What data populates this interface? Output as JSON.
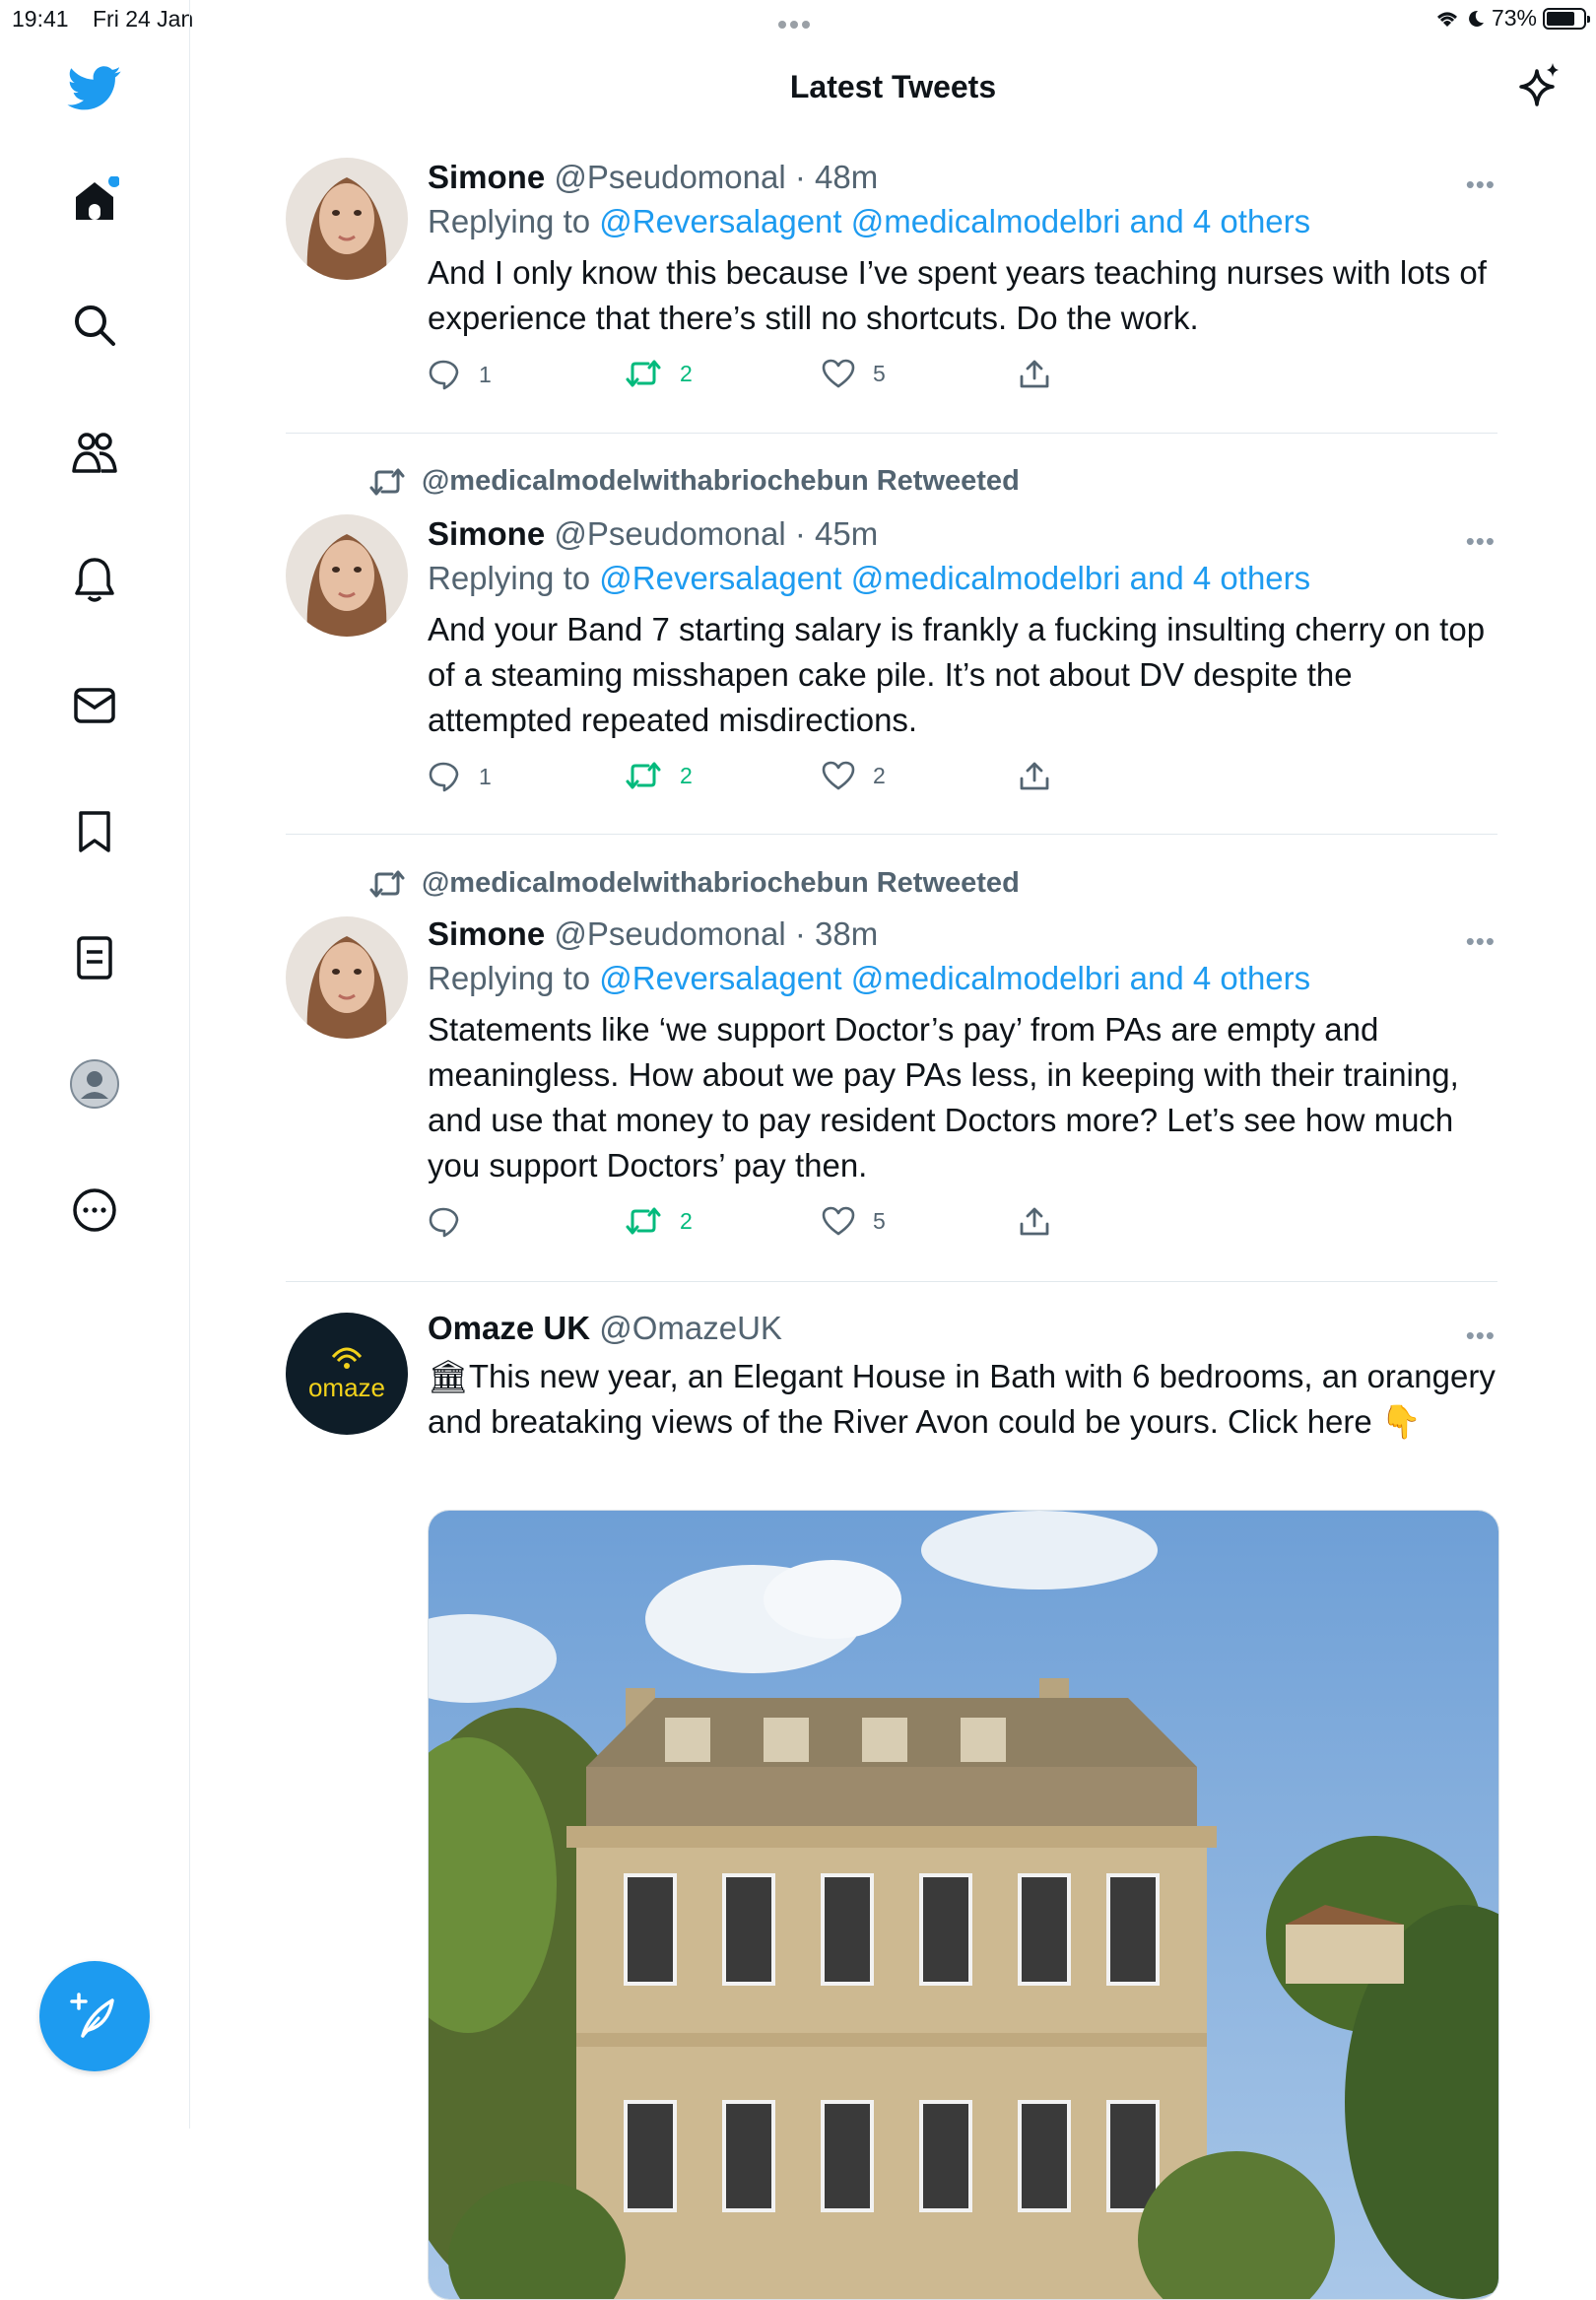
{
  "status_bar": {
    "time": "19:41",
    "date": "Fri 24 Jan",
    "battery": "73%",
    "battery_level": 0.73
  },
  "header": {
    "title": "Latest Tweets"
  },
  "sidebar": {
    "icons": [
      "twitter-logo-icon",
      "home-icon",
      "search-icon",
      "communities-icon",
      "notifications-icon",
      "messages-icon",
      "bookmarks-icon",
      "lists-icon",
      "profile-icon",
      "more-icon"
    ],
    "compose_icon": "compose-tweet-icon"
  },
  "tweets": [
    {
      "retweeted_by": "",
      "name": "Simone",
      "handle": "@Pseudomonal",
      "time": "· 48m",
      "replying_prefix": "Replying to",
      "replying_to": "@Reversalagent @medicalmodelbri and 4 others",
      "text": "And I only know this because I’ve spent years teaching nurses with lots of experience that there’s still no shortcuts. Do the work.",
      "replies": "1",
      "retweets": "2",
      "likes": "5"
    },
    {
      "retweeted_by": "@medicalmodelwithabriochebun Retweeted",
      "name": "Simone",
      "handle": "@Pseudomonal",
      "time": "· 45m",
      "replying_prefix": "Replying to",
      "replying_to": "@Reversalagent @medicalmodelbri and 4 others",
      "text": "And your Band 7 starting salary is frankly a fucking insulting cherry on top of a steaming misshapen cake pile. It’s not about DV despite the attempted repeated misdirections.",
      "replies": "1",
      "retweets": "2",
      "likes": "2"
    },
    {
      "retweeted_by": "@medicalmodelwithabriochebun Retweeted",
      "name": "Simone",
      "handle": "@Pseudomonal",
      "time": "· 38m",
      "replying_prefix": "Replying to",
      "replying_to": "@Reversalagent @medicalmodelbri and 4 others",
      "text": "Statements like ‘we support Doctor’s pay’ from PAs are empty and meaningless. How about we pay PAs less, in keeping with their training, and use that money to pay resident Doctors more? Let’s see how much you support Doctors’ pay then.",
      "replies": "",
      "retweets": "2",
      "likes": "5"
    },
    {
      "retweeted_by": "",
      "name": "Omaze UK",
      "handle": "@OmazeUK",
      "avatar_text": "omaze",
      "text": "🏛This new year, an Elegant House in Bath with 6 bedrooms, an orangery and breataking views of the River Avon could be yours. Click here 👇"
    }
  ],
  "more_label": "•••",
  "colors": {
    "accent": "#1d9bf0",
    "retweet_green": "#00ba7c",
    "secondary_text": "#536471"
  }
}
